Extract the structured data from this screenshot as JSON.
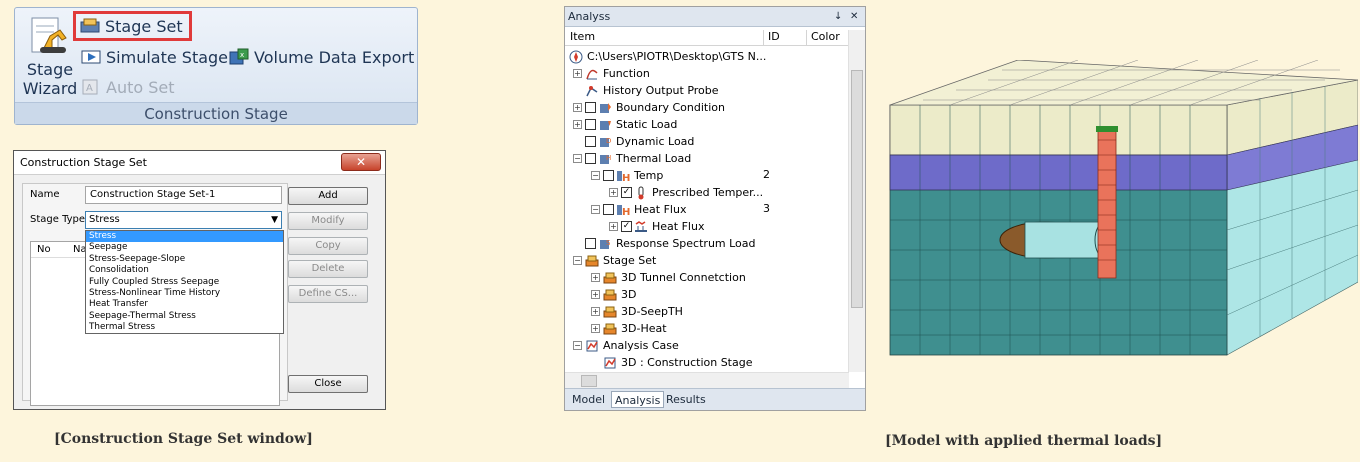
{
  "ribbon": {
    "wizard_label_1": "Stage",
    "wizard_label_2": "Wizard",
    "stage_set": "Stage Set",
    "simulate_stage": "Simulate Stage",
    "volume_export": "Volume Data Export",
    "auto_set": "Auto Set",
    "group_label": "Construction Stage"
  },
  "dialog": {
    "title": "Construction Stage Set",
    "name_label": "Name",
    "name_value": "Construction Stage Set-1",
    "stage_type_label": "Stage Type",
    "stage_type_value": "Stress",
    "list_headers": [
      "No",
      "Na"
    ],
    "options": [
      "Stress",
      "Seepage",
      "Stress-Seepage-Slope",
      "Consolidation",
      "Fully Coupled Stress Seepage",
      "Stress-Nonlinear Time History",
      "Heat Transfer",
      "Seepage-Thermal Stress",
      "Thermal Stress"
    ],
    "buttons": {
      "add": "Add",
      "modify": "Modify",
      "copy": "Copy",
      "delete": "Delete",
      "define_cs": "Define CS...",
      "close": "Close"
    }
  },
  "captions": {
    "left": "[Construction Stage Set window]",
    "right": "[Model with applied  thermal loads]"
  },
  "panel": {
    "title": "Analyss",
    "pin": "↓",
    "close": "✕",
    "columns": {
      "item": "Item",
      "id": "ID",
      "color": "Color"
    },
    "rows": [
      {
        "label": "C:\\Users\\PIOTR\\Desktop\\GTS N...",
        "id": ""
      },
      {
        "label": "Function",
        "id": ""
      },
      {
        "label": "History Output Probe",
        "id": ""
      },
      {
        "label": "Boundary Condition",
        "id": ""
      },
      {
        "label": "Static Load",
        "id": ""
      },
      {
        "label": "Dynamic Load",
        "id": ""
      },
      {
        "label": "Thermal Load",
        "id": ""
      },
      {
        "label": "Temp",
        "id": "2"
      },
      {
        "label": "Prescribed Temper...",
        "id": ""
      },
      {
        "label": "Heat Flux",
        "id": "3"
      },
      {
        "label": "Heat Flux",
        "id": ""
      },
      {
        "label": "Response Spectrum Load",
        "id": ""
      },
      {
        "label": "Stage Set",
        "id": ""
      },
      {
        "label": "3D Tunnel Connetction",
        "id": ""
      },
      {
        "label": "3D",
        "id": ""
      },
      {
        "label": "3D-SeepTH",
        "id": ""
      },
      {
        "label": "3D-Heat",
        "id": ""
      },
      {
        "label": "Analysis Case",
        "id": ""
      },
      {
        "label": "3D : Construction Stage",
        "id": ""
      }
    ],
    "tabs": [
      "Model",
      "Analysis",
      "Results"
    ]
  },
  "colors": {
    "highlight": "#e03a3a",
    "selection": "#3399ff",
    "layer_top": "#ecebc9",
    "layer_mid": "#7e7bd4",
    "layer_soil": "#a8e2e2"
  }
}
